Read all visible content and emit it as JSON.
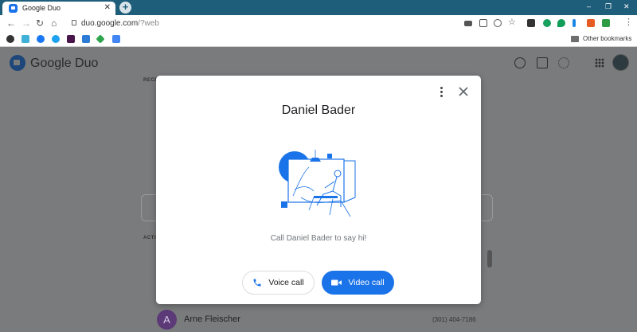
{
  "browser": {
    "tab_title": "Google Duo",
    "tab_close": "✕",
    "new_tab": "+",
    "url_host": "duo.google.com",
    "url_path": "/?web",
    "window_controls": [
      "‒",
      "❐",
      "✕"
    ],
    "other_bookmarks": "Other bookmarks"
  },
  "app": {
    "name": "Google Duo",
    "recent_label": "RECE",
    "active_label": "ACTI",
    "contact": {
      "initial": "A",
      "name": "Arne Fleischer",
      "phone": "(301) 404-7186"
    }
  },
  "modal": {
    "title": "Daniel Bader",
    "message": "Call Daniel Bader to say hi!",
    "voice_button": "Voice call",
    "video_button": "Video call"
  },
  "colors": {
    "accent": "#1a73e8",
    "chrome": "#1f5e7a",
    "overlay": "#7a7b7c"
  }
}
